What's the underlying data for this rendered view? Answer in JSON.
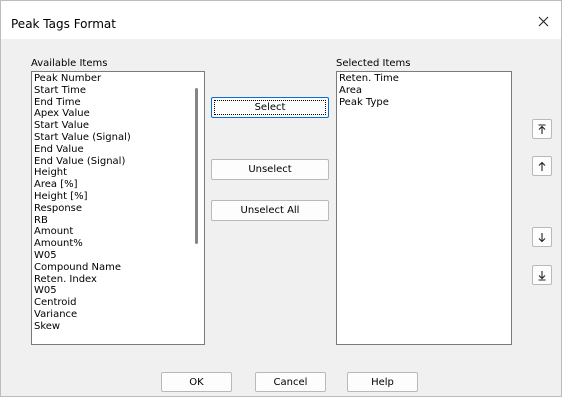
{
  "window": {
    "title": "Peak Tags Format"
  },
  "available": {
    "label": "Available Items",
    "items": [
      "Peak Number",
      "Start Time",
      "End Time",
      "Apex Value",
      "Start Value",
      "Start Value (Signal)",
      "End Value",
      "End Value (Signal)",
      "Height",
      "Area [%]",
      "Height [%]",
      "Response",
      "RB",
      "Amount",
      "Amount%",
      "W05",
      "Compound Name",
      "Reten. Index",
      "W05",
      "Centroid",
      "Variance",
      "Skew"
    ]
  },
  "selected": {
    "label": "Selected Items",
    "items": [
      "Reten. Time",
      "Area",
      "Peak Type"
    ]
  },
  "buttons": {
    "select": "Select",
    "unselect": "Unselect",
    "unselect_all": "Unselect All",
    "ok": "OK",
    "cancel": "Cancel",
    "help": "Help"
  },
  "icons": {
    "close": "close-icon",
    "move_top": "move-to-top-icon",
    "move_up": "move-up-icon",
    "move_down": "move-down-icon",
    "move_bottom": "move-to-bottom-icon"
  }
}
